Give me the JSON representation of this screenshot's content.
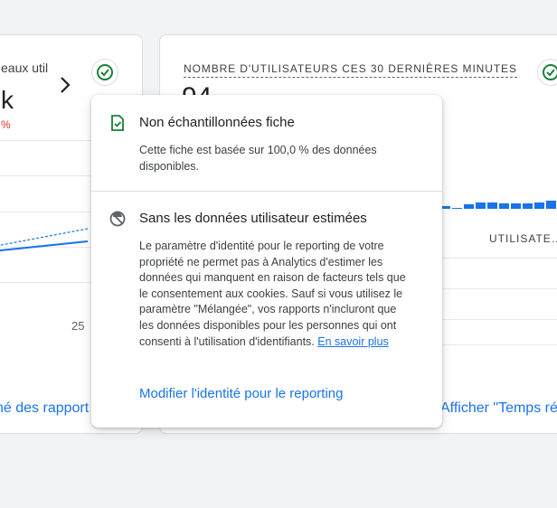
{
  "left_card": {
    "title": "eaux util",
    "value": "k",
    "change": "%",
    "x_tick": "25",
    "link": "né des rapport"
  },
  "right_card": {
    "title": "Nombre d'utilisateurs ces 30 dernières minutes",
    "value": "94",
    "column_header": "UTILISATE…",
    "link": "Afficher \"Temps ré"
  },
  "popover": {
    "section1": {
      "heading": "Non échantillonnées fiche",
      "body": "Cette fiche est basée sur 100,0 % des données disponibles."
    },
    "section2": {
      "heading": "Sans les données utilisateur estimées",
      "body": "Le paramètre d'identité pour le reporting de votre propriété ne permet pas à Analytics d'estimer les données qui manquent en raison de facteurs tels que le consentement aux cookies. Sauf si vous utilisez le paramètre \"Mélangée\", vos rapports n'incluront que les données disponibles pour les personnes qui ont consenti à l'utilisation d'identifiants.",
      "learn_more": "En savoir plus"
    },
    "action": "Modifier l'identité pour le reporting"
  },
  "icons": {
    "status": "check-circle-icon",
    "sampling": "check-document-icon",
    "identity": "no-estimate-icon"
  },
  "colors": {
    "accent": "#1a73e8",
    "success": "#188038",
    "negative": "#d93025"
  }
}
